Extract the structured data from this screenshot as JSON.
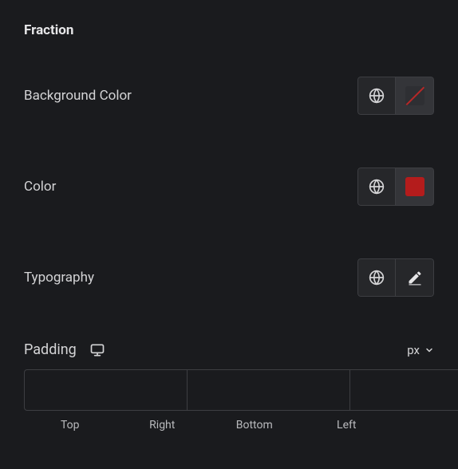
{
  "section": {
    "title": "Fraction"
  },
  "bgcolor": {
    "label": "Background Color",
    "value": null
  },
  "color": {
    "label": "Color",
    "value": "#b41c1c"
  },
  "typography": {
    "label": "Typography"
  },
  "padding": {
    "label": "Padding",
    "unit": "px",
    "sides": {
      "top": "Top",
      "right": "Right",
      "bottom": "Bottom",
      "left": "Left"
    },
    "values": {
      "top": "",
      "right": "",
      "bottom": "",
      "left": ""
    }
  }
}
